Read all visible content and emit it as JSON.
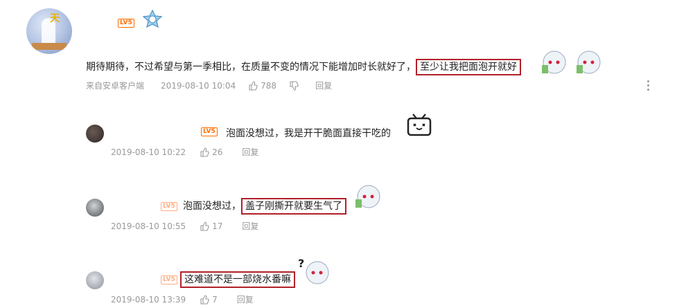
{
  "main_comment": {
    "level": "LV5",
    "text_plain": "期待期待，不过希望与第一季相比，在质量不变的情况下能增加时长就好了，",
    "text_highlight": "至少让我把面泡开就好",
    "source": "来自安卓客户端",
    "time": "2019-08-10 10:04",
    "likes": "788",
    "reply_label": "回复"
  },
  "replies": [
    {
      "level": "LV5",
      "text_plain": "泡面没想过，我是开干脆面直接干吃的",
      "text_highlight": "",
      "time": "2019-08-10 10:22",
      "likes": "26",
      "reply_label": "回复"
    },
    {
      "level": "LV5",
      "text_plain": "泡面没想过，",
      "text_highlight": "盖子刚撕开就要生气了",
      "time": "2019-08-10 10:55",
      "likes": "17",
      "reply_label": "回复"
    },
    {
      "level": "LV5",
      "text_plain": "",
      "text_highlight": "这难道不是一部烧水番嘛",
      "time": "2019-08-10 13:39",
      "likes": "7",
      "reply_label": "回复"
    }
  ],
  "colors": {
    "highlight_border": "#b0202a",
    "level_badge": "#ff6c00",
    "meta_text": "#999999"
  }
}
